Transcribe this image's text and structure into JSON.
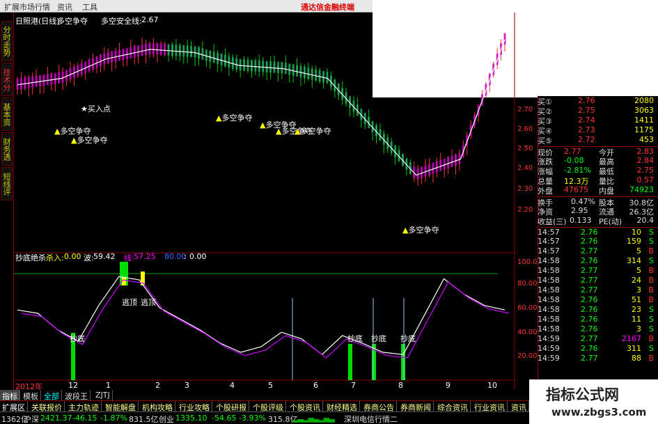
{
  "menu": {
    "items": [
      "扩展市场行情",
      "资讯",
      "工具"
    ],
    "brand": "通达信金融终端"
  },
  "vtabs": [
    "分时走势",
    "技术分析",
    "基本资料",
    "财务透视",
    "短线评级"
  ],
  "main_chart": {
    "title": "日照港(日线)",
    "indicator": "多空争夺",
    "safe_line_label": "多空安全线:",
    "safe_line_value": "2.67",
    "buy_point": "★买入点",
    "signal_label": "多空争夺",
    "y_ticks": [
      "2.70",
      "2.60",
      "2.50",
      "2.40",
      "2.30",
      "2.20"
    ],
    "right_marker": "2.5"
  },
  "sub_chart": {
    "name": "抄底绝杀",
    "fields": [
      {
        "label": "杀入:",
        "value": "0.00"
      },
      {
        "label": "波:",
        "value": "59.42"
      },
      {
        "label": "线:",
        "value": "57.25"
      },
      {
        "label": "",
        "value": "80.00"
      },
      {
        "label": ":",
        "value": "0.00"
      }
    ],
    "tag_top": "逃顶",
    "tag_bottom": "抄底",
    "y_ticks": [
      "100.0",
      "80.00",
      "60.00",
      "40.00",
      "20.00"
    ]
  },
  "x_axis": {
    "year": "2012年",
    "ticks": [
      "12",
      "1",
      "2",
      "3",
      "4",
      "5",
      "6",
      "7",
      "8",
      "9",
      "10"
    ]
  },
  "chart_data": {
    "type": "line",
    "title": "",
    "xlabel": "",
    "ylabel": "",
    "x_ticks": [
      "12",
      "1",
      "2",
      "3",
      "4",
      "5",
      "6",
      "7",
      "8",
      "9",
      "10"
    ],
    "ylim": [
      2.2,
      2.75
    ],
    "series": [
      {
        "name": "多空安全线",
        "values": [
          2.58,
          2.6,
          2.66,
          2.69,
          2.68,
          2.64,
          2.63,
          2.6,
          2.45,
          2.3,
          2.35,
          2.72
        ]
      }
    ],
    "sub_ylim": [
      0,
      100
    ],
    "sub_series": [
      {
        "values": [
          58,
          55,
          40,
          30,
          62,
          88,
          85,
          60,
          50,
          40,
          28,
          20,
          25,
          38,
          32,
          18,
          35,
          28,
          20,
          18,
          52,
          86,
          72,
          62,
          58
        ]
      }
    ]
  },
  "quote_panel": {
    "bids": [
      {
        "label": "买①",
        "price": "2.76",
        "vol": "2080"
      },
      {
        "label": "买②",
        "price": "2.75",
        "vol": "3063"
      },
      {
        "label": "买③",
        "price": "2.74",
        "vol": "1411"
      },
      {
        "label": "买④",
        "price": "2.73",
        "vol": "1175"
      },
      {
        "label": "买⑤",
        "price": "2.72",
        "vol": "453"
      }
    ],
    "stats": [
      {
        "l1": "现价",
        "v1": "2.77",
        "l2": "今开",
        "v2": "2.83"
      },
      {
        "l1": "涨跌",
        "v1": "-0.08",
        "l2": "最高",
        "v2": "2.84"
      },
      {
        "l1": "涨幅",
        "v1": "-2.81%",
        "l2": "最低",
        "v2": "2.75"
      },
      {
        "l1": "总量",
        "v1": "12.3万",
        "l2": "量比",
        "v2": "0.57"
      },
      {
        "l1": "外盘",
        "v1": "47675",
        "l2": "内盘",
        "v2": "74923"
      }
    ],
    "stats2": [
      {
        "l1": "换手",
        "v1": "0.47%",
        "l2": "股本",
        "v2": "30.8亿"
      },
      {
        "l1": "净资",
        "v1": "2.95",
        "l2": "流通",
        "v2": "26.3亿"
      },
      {
        "l1": "收益(三)",
        "v1": "0.133",
        "l2": "PE(动)",
        "v2": "20.4"
      }
    ],
    "ticks": [
      {
        "t": "14:57",
        "p": "2.76",
        "v": "10",
        "s": "S"
      },
      {
        "t": "14:57",
        "p": "2.76",
        "v": "159",
        "s": "S"
      },
      {
        "t": "14:57",
        "p": "2.77",
        "v": "5",
        "s": "B"
      },
      {
        "t": "14:58",
        "p": "2.76",
        "v": "314",
        "s": "S"
      },
      {
        "t": "14:58",
        "p": "2.77",
        "v": "5",
        "s": "B"
      },
      {
        "t": "14:58",
        "p": "2.77",
        "v": "24",
        "s": "B"
      },
      {
        "t": "14:58",
        "p": "2.77",
        "v": "3",
        "s": "B"
      },
      {
        "t": "14:58",
        "p": "2.76",
        "v": "51",
        "s": "B"
      },
      {
        "t": "14:58",
        "p": "2.76",
        "v": "23",
        "s": "S"
      },
      {
        "t": "14:58",
        "p": "2.76",
        "v": "11",
        "s": "S"
      },
      {
        "t": "14:58",
        "p": "2.76",
        "v": "3",
        "s": "S"
      },
      {
        "t": "14:59",
        "p": "2.77",
        "v": "2167",
        "s": "B"
      },
      {
        "t": "14:59",
        "p": "2.76",
        "v": "311",
        "s": "S"
      },
      {
        "t": "14:59",
        "p": "2.77",
        "v": "88",
        "s": "B"
      }
    ]
  },
  "tabs_row1": [
    "指标",
    "模板",
    "全部",
    "波段王",
    "ZJTJ"
  ],
  "tabs_row2": [
    "扩展区",
    "关联报价",
    "主力轨迹",
    "智能解盘",
    "机构攻略",
    "行业攻略",
    "个股研报",
    "个股评级",
    "个股资讯",
    "财经精选",
    "券商公告",
    "券商新闻",
    "综合资讯",
    "行业资讯",
    "资讯"
  ],
  "status_bar": {
    "code": "1362亿",
    "sh_label": "沪深",
    "sh_val": "2421.37",
    "sh_chg": "-46.15",
    "sh_pct": "-1.87%",
    "sh_amt": "831.5亿",
    "cy_label": "创业",
    "cy_val": "1335.10",
    "cy_chg": "-54.65",
    "cy_pct": "-3.93%",
    "cy_amt": "315.8亿",
    "server": "深圳电信行情二"
  },
  "watermark": {
    "title": "指标公式网",
    "url": "www.zbgs3.com"
  },
  "colors": {
    "up": "#ff3333",
    "down": "#00ff00",
    "background": "#000000",
    "yellow": "#ffff00"
  }
}
